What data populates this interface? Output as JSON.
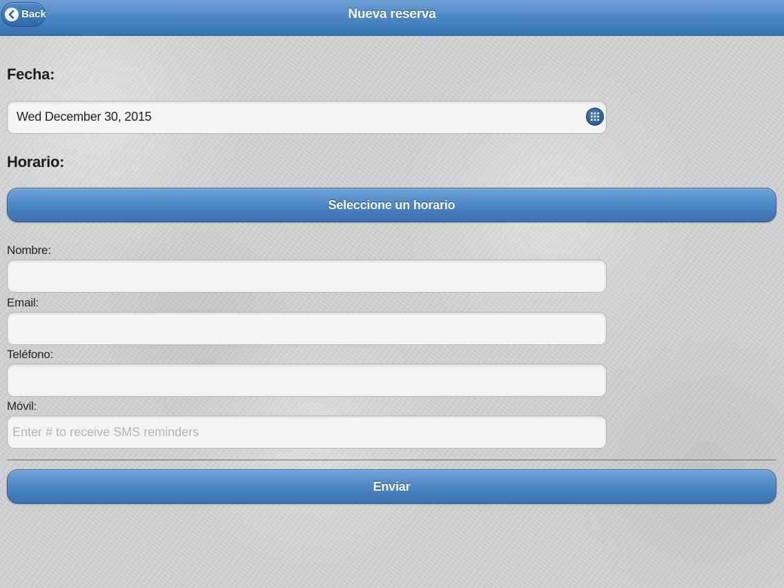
{
  "header": {
    "title": "Nueva reserva",
    "back_label": "Back"
  },
  "form": {
    "fecha_label": "Fecha:",
    "date_value": "Wed December 30, 2015",
    "horario_label": "Horario:",
    "horario_button": "Seleccione un horario",
    "nombre_label": "Nombre:",
    "nombre_value": "",
    "email_label": "Email:",
    "email_value": "",
    "telefono_label": "Teléfono:",
    "telefono_value": "",
    "movil_label": "Móvil:",
    "movil_placeholder": "Enter # to receive SMS reminders",
    "submit_button": "Enviar"
  },
  "icons": {
    "back": "chevron-left-icon",
    "calendar": "calendar-grid-icon"
  },
  "colors": {
    "header_blue": "#4d86c3",
    "button_blue": "#4a84c2"
  }
}
